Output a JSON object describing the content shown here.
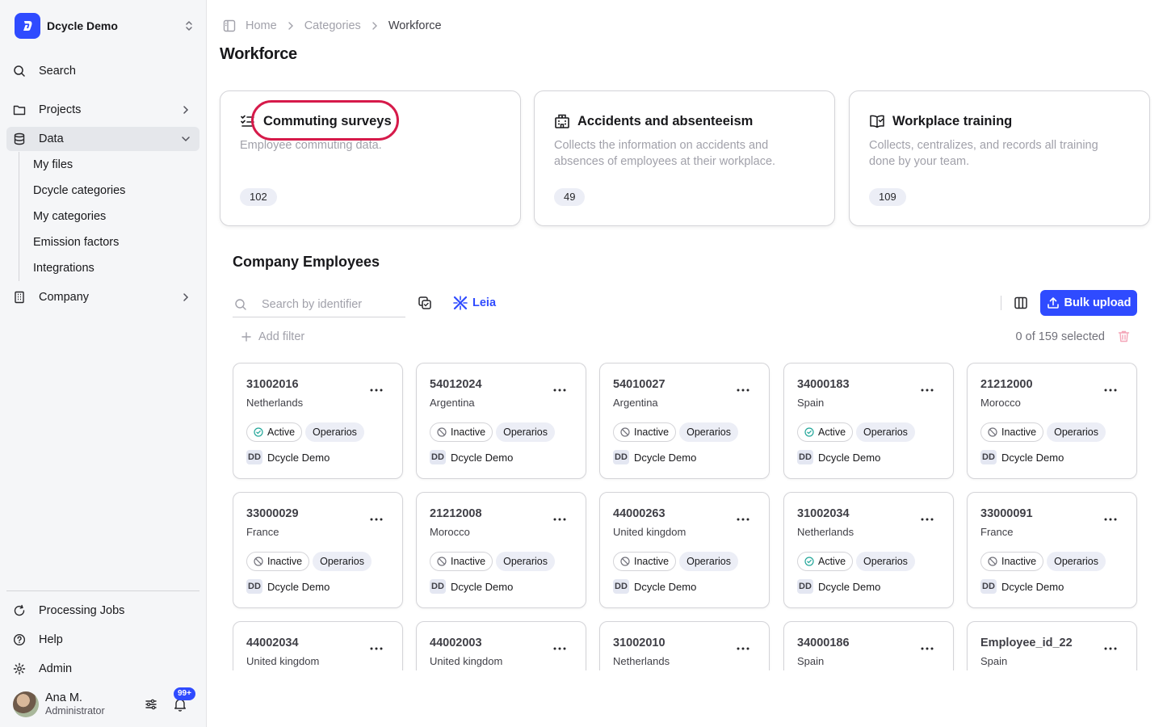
{
  "sidebar": {
    "org_name": "Dcycle Demo",
    "search_label": "Search",
    "projects_label": "Projects",
    "data_label": "Data",
    "data_subitems": [
      "My files",
      "Dcycle categories",
      "My categories",
      "Emission factors",
      "Integrations"
    ],
    "company_label": "Company",
    "processing_jobs_label": "Processing Jobs",
    "help_label": "Help",
    "admin_label": "Admin",
    "user": {
      "name": "Ana M.",
      "role": "Administrator",
      "notifications_badge": "99+"
    }
  },
  "breadcrumb": {
    "home": "Home",
    "categories": "Categories",
    "current": "Workforce"
  },
  "page_title": "Workforce",
  "category_cards": [
    {
      "title": "Commuting surveys",
      "description": "Employee commuting data.",
      "count": "102",
      "icon": "checklist-icon"
    },
    {
      "title": "Accidents and absenteeism",
      "description": "Collects the information on accidents and absences of employees at their workplace.",
      "count": "49",
      "icon": "hospital-icon"
    },
    {
      "title": "Workplace training",
      "description": "Collects, centralizes, and records all training done by your team.",
      "count": "109",
      "icon": "book-check-icon"
    }
  ],
  "employees_section": {
    "title": "Company Employees",
    "search_placeholder": "Search by identifier",
    "leia_label": "Leia",
    "bulk_upload_label": "Bulk upload",
    "add_filter_label": "Add filter",
    "selected_text": "0 of 159 selected"
  },
  "employees": [
    {
      "id": "31002016",
      "country": "Netherlands",
      "status": "Active",
      "group": "Operarios",
      "owner_initials": "DD",
      "owner": "Dcycle Demo"
    },
    {
      "id": "54012024",
      "country": "Argentina",
      "status": "Inactive",
      "group": "Operarios",
      "owner_initials": "DD",
      "owner": "Dcycle Demo"
    },
    {
      "id": "54010027",
      "country": "Argentina",
      "status": "Inactive",
      "group": "Operarios",
      "owner_initials": "DD",
      "owner": "Dcycle Demo"
    },
    {
      "id": "34000183",
      "country": "Spain",
      "status": "Active",
      "group": "Operarios",
      "owner_initials": "DD",
      "owner": "Dcycle Demo"
    },
    {
      "id": "21212000",
      "country": "Morocco",
      "status": "Inactive",
      "group": "Operarios",
      "owner_initials": "DD",
      "owner": "Dcycle Demo"
    },
    {
      "id": "33000029",
      "country": "France",
      "status": "Inactive",
      "group": "Operarios",
      "owner_initials": "DD",
      "owner": "Dcycle Demo"
    },
    {
      "id": "21212008",
      "country": "Morocco",
      "status": "Inactive",
      "group": "Operarios",
      "owner_initials": "DD",
      "owner": "Dcycle Demo"
    },
    {
      "id": "44000263",
      "country": "United kingdom",
      "status": "Inactive",
      "group": "Operarios",
      "owner_initials": "DD",
      "owner": "Dcycle Demo"
    },
    {
      "id": "31002034",
      "country": "Netherlands",
      "status": "Active",
      "group": "Operarios",
      "owner_initials": "DD",
      "owner": "Dcycle Demo"
    },
    {
      "id": "33000091",
      "country": "France",
      "status": "Inactive",
      "group": "Operarios",
      "owner_initials": "DD",
      "owner": "Dcycle Demo"
    },
    {
      "id": "44002034",
      "country": "United kingdom",
      "status": "",
      "group": "",
      "owner_initials": "",
      "owner": ""
    },
    {
      "id": "44002003",
      "country": "United kingdom",
      "status": "",
      "group": "",
      "owner_initials": "",
      "owner": ""
    },
    {
      "id": "31002010",
      "country": "Netherlands",
      "status": "",
      "group": "",
      "owner_initials": "",
      "owner": ""
    },
    {
      "id": "34000186",
      "country": "Spain",
      "status": "",
      "group": "",
      "owner_initials": "",
      "owner": ""
    },
    {
      "id": "Employee_id_22",
      "country": "Spain",
      "status": "",
      "group": "",
      "owner_initials": "",
      "owner": ""
    }
  ],
  "colors": {
    "accent": "#2f4bff",
    "highlight_ring": "#d61a4a",
    "active_check": "#22a699",
    "sidebar_bg": "#f5f6f8",
    "danger": "#f4a6b8"
  }
}
